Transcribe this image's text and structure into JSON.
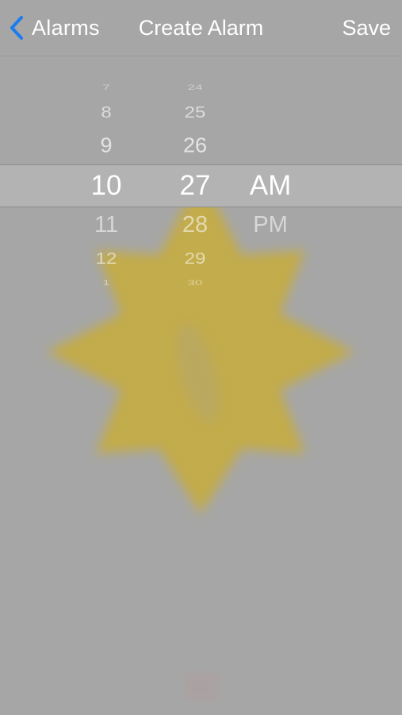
{
  "navbar": {
    "back_label": "Alarms",
    "title": "Create Alarm",
    "save_label": "Save"
  },
  "picker": {
    "hours": [
      "7",
      "8",
      "9",
      "10",
      "11",
      "12",
      "1"
    ],
    "minutes": [
      "24",
      "25",
      "26",
      "27",
      "28",
      "29",
      "30"
    ],
    "periods": [
      "AM",
      "PM"
    ],
    "selected": {
      "hour": "10",
      "minute": "27",
      "period": "AM"
    }
  },
  "icons": {
    "back": "chevron-left-icon",
    "background": "sun-icon"
  },
  "colors": {
    "background": "#a6a6a6",
    "accent": "#1a7cf0",
    "text": "#ffffff",
    "sun": "#c8ad3b"
  }
}
